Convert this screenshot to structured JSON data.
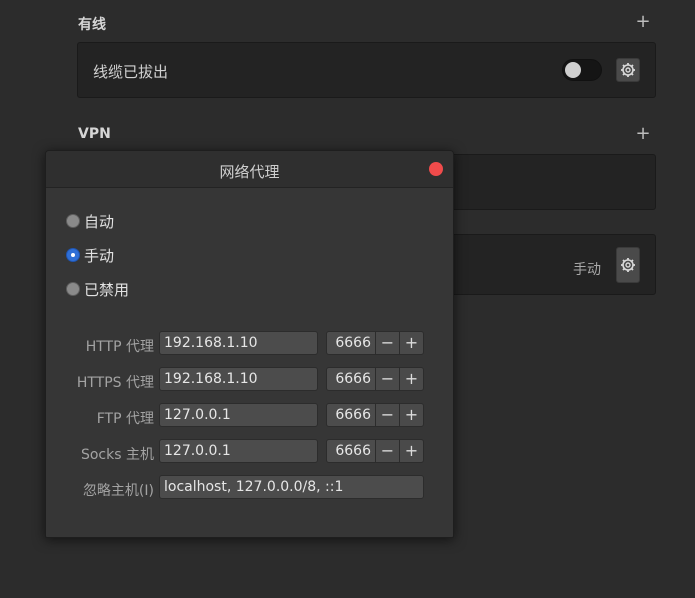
{
  "wired": {
    "title": "有线",
    "add_label": "+",
    "status": "线缆已拔出",
    "toggle_on": false
  },
  "vpn": {
    "title": "VPN",
    "add_label": "+"
  },
  "proxy_row": {
    "mode_text": "手动"
  },
  "dialog": {
    "title": "网络代理",
    "radios": [
      {
        "label": "自动",
        "checked": false
      },
      {
        "label": "手动",
        "checked": true
      },
      {
        "label": "已禁用",
        "checked": false
      }
    ],
    "fields": [
      {
        "label": "HTTP 代理",
        "host": "192.168.1.10",
        "port": "6666"
      },
      {
        "label": "HTTPS 代理",
        "host": "192.168.1.10",
        "port": "6666"
      },
      {
        "label": "FTP 代理",
        "host": "127.0.0.1",
        "port": "6666"
      },
      {
        "label": "Socks 主机",
        "host": "127.0.0.1",
        "port": "6666"
      }
    ],
    "ignore": {
      "label": "忽略主机(I)",
      "value": "localhost, 127.0.0.0/8, ::1"
    },
    "minus_label": "−",
    "plus_label": "+"
  },
  "colors": {
    "background": "#2c2c2c",
    "panel": "#232323",
    "dialog": "#363636",
    "close": "#f04b4b",
    "radio_checked": "#2f6fd6"
  }
}
